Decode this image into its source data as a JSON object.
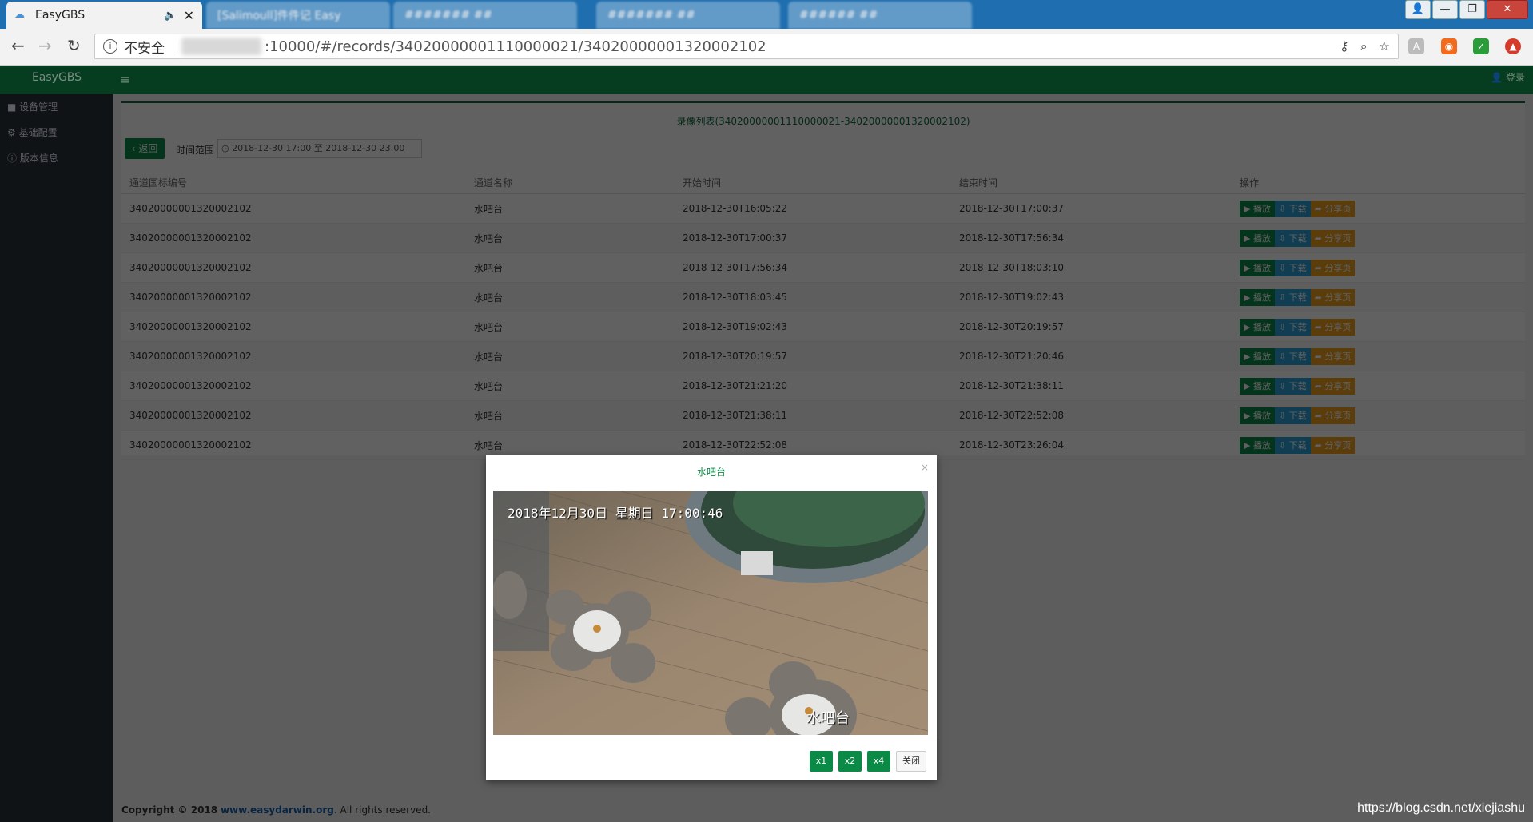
{
  "browser": {
    "active_tab": {
      "title": "EasyGBS",
      "audio_icon": "speaker-icon",
      "close_label": "✕"
    },
    "other_tabs": [
      "[Salimoull]件件记 Easy",
      "####### ##",
      "####### ##",
      "###### ##"
    ],
    "window_buttons": {
      "user": "👤",
      "minimize": "—",
      "restore": "❐",
      "close": "✕"
    },
    "address": {
      "security_label": "不安全",
      "url": ":10000/#/records/34020000001110000021/34020000001320002102"
    }
  },
  "app": {
    "brand": "EasyGBS",
    "login_label": "登录",
    "sidebar": [
      {
        "icon": "video-camera-icon",
        "label": "设备管理"
      },
      {
        "icon": "gears-icon",
        "label": "基础配置"
      },
      {
        "icon": "info-circle-icon",
        "label": "版本信息"
      }
    ],
    "records": {
      "title": "录像列表(34020000001110000021-34020000001320002102)",
      "back_label": "返回",
      "range_label": "时间范围",
      "range_value": "2018-12-30 17:00 至 2018-12-30 23:00",
      "columns": [
        "通道国标编号",
        "通道名称",
        "开始时间",
        "结束时间",
        "操作"
      ],
      "rows": [
        [
          "34020000001320002102",
          "水吧台",
          "2018-12-30T16:05:22",
          "2018-12-30T17:00:37"
        ],
        [
          "34020000001320002102",
          "水吧台",
          "2018-12-30T17:00:37",
          "2018-12-30T17:56:34"
        ],
        [
          "34020000001320002102",
          "水吧台",
          "2018-12-30T17:56:34",
          "2018-12-30T18:03:10"
        ],
        [
          "34020000001320002102",
          "水吧台",
          "2018-12-30T18:03:45",
          "2018-12-30T19:02:43"
        ],
        [
          "34020000001320002102",
          "水吧台",
          "2018-12-30T19:02:43",
          "2018-12-30T20:19:57"
        ],
        [
          "34020000001320002102",
          "水吧台",
          "2018-12-30T20:19:57",
          "2018-12-30T21:20:46"
        ],
        [
          "34020000001320002102",
          "水吧台",
          "2018-12-30T21:21:20",
          "2018-12-30T21:38:11"
        ],
        [
          "34020000001320002102",
          "水吧台",
          "2018-12-30T21:38:11",
          "2018-12-30T22:52:08"
        ],
        [
          "34020000001320002102",
          "水吧台",
          "2018-12-30T22:52:08",
          "2018-12-30T23:26:04"
        ]
      ],
      "op_labels": {
        "play": "播放",
        "download": "下载",
        "share": "分享页"
      }
    },
    "footer": {
      "prefix": "Copyright © 2018",
      "link": "www.easydarwin.org",
      "suffix": ". All rights reserved."
    },
    "watermark": "https://blog.csdn.net/xiejiashu"
  },
  "modal": {
    "title": "水吧台",
    "close_x": "×",
    "video": {
      "osd_time": "2018年12月30日 星期日 17:00:46",
      "osd_name": "水吧台"
    },
    "speed_buttons": [
      "x1",
      "x2",
      "x4"
    ],
    "close_label": "关闭"
  },
  "colors": {
    "brand_green": "#0b6e3b",
    "play": "#0b8a47",
    "download": "#2aa0d8",
    "share": "#f0a020"
  }
}
